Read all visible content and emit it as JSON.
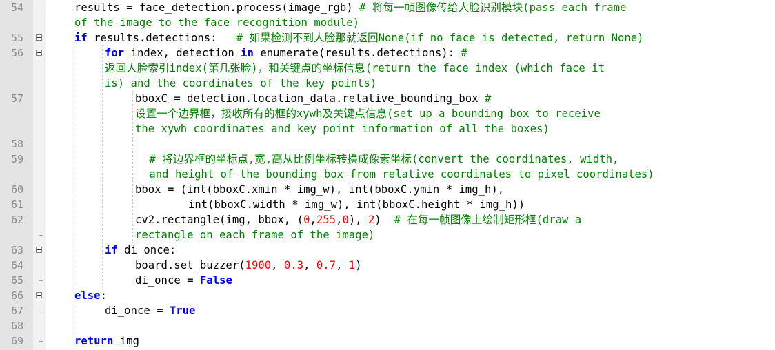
{
  "editor": {
    "lines": [
      {
        "num": "54",
        "segments": [
          {
            "t": "results = face_detection.process(image_rgb) ",
            "c": "plain"
          },
          {
            "t": "# 将每一帧图像传给人脸识别模块(pass each frame",
            "c": "cm"
          }
        ]
      },
      {
        "num": "",
        "segments": [
          {
            "t": "of the image to the face recognition module)",
            "c": "cm"
          }
        ]
      },
      {
        "num": "55",
        "segments": [
          {
            "t": "if",
            "c": "kw"
          },
          {
            "t": " results.detections:   ",
            "c": "plain"
          },
          {
            "t": "# 如果检测不到人脸那就返回None(if no face is detected, return None)",
            "c": "cm"
          }
        ]
      },
      {
        "num": "56",
        "segments": [
          {
            "t": "for",
            "c": "kw"
          },
          {
            "t": " index, detection ",
            "c": "plain"
          },
          {
            "t": "in",
            "c": "kw"
          },
          {
            "t": " enumerate(results.detections): ",
            "c": "plain"
          },
          {
            "t": "#",
            "c": "cm"
          }
        ]
      },
      {
        "num": "",
        "segments": [
          {
            "t": "返回人脸索引index(第几张脸)，和关键点的坐标信息(return the face index (which face it",
            "c": "cm"
          }
        ]
      },
      {
        "num": "",
        "segments": [
          {
            "t": "is) and the coordinates of the key points)",
            "c": "cm"
          }
        ]
      },
      {
        "num": "57",
        "segments": [
          {
            "t": "bboxC = detection.location_data.relative_bounding_box ",
            "c": "plain"
          },
          {
            "t": "#",
            "c": "cm"
          }
        ]
      },
      {
        "num": "",
        "segments": [
          {
            "t": "设置一个边界框，接收所有的框的xywh及关键点信息(set up a bounding box to receive",
            "c": "cm"
          }
        ]
      },
      {
        "num": "",
        "segments": [
          {
            "t": "the xywh coordinates and key point information of all the boxes)",
            "c": "cm"
          }
        ]
      },
      {
        "num": "58",
        "segments": []
      },
      {
        "num": "59",
        "segments": [
          {
            "t": " # 将边界框的坐标点,宽,高从比例坐标转换成像素坐标(convert the coordinates, width,",
            "c": "cm"
          }
        ]
      },
      {
        "num": "",
        "segments": [
          {
            "t": " and height of the bounding box from relative coordinates to pixel coordinates)",
            "c": "cm"
          }
        ]
      },
      {
        "num": "60",
        "segments": [
          {
            "t": "bbox = (int(bboxC.xmin * img_w), int(bboxC.ymin * img_h),",
            "c": "plain"
          }
        ]
      },
      {
        "num": "61",
        "segments": [
          {
            "t": "int(bboxC.width * img_w), int(bboxC.height * img_h))",
            "c": "plain"
          }
        ]
      },
      {
        "num": "62",
        "segments": [
          {
            "t": "cv2.rectangle(img, bbox, (",
            "c": "plain"
          },
          {
            "t": "0",
            "c": "num"
          },
          {
            "t": ",",
            "c": "plain"
          },
          {
            "t": "255",
            "c": "num"
          },
          {
            "t": ",",
            "c": "plain"
          },
          {
            "t": "0",
            "c": "num"
          },
          {
            "t": "), ",
            "c": "plain"
          },
          {
            "t": "2",
            "c": "num"
          },
          {
            "t": ")  ",
            "c": "plain"
          },
          {
            "t": "# 在每一帧图像上绘制矩形框(draw a",
            "c": "cm"
          }
        ]
      },
      {
        "num": "",
        "segments": [
          {
            "t": "rectangle on each frame of the image)",
            "c": "cm"
          }
        ]
      },
      {
        "num": "63",
        "segments": [
          {
            "t": "if",
            "c": "kw"
          },
          {
            "t": " di_once:",
            "c": "plain"
          }
        ]
      },
      {
        "num": "64",
        "segments": [
          {
            "t": "board.set_buzzer(",
            "c": "plain"
          },
          {
            "t": "1900",
            "c": "num"
          },
          {
            "t": ", ",
            "c": "plain"
          },
          {
            "t": "0.3",
            "c": "num"
          },
          {
            "t": ", ",
            "c": "plain"
          },
          {
            "t": "0.7",
            "c": "num"
          },
          {
            "t": ", ",
            "c": "plain"
          },
          {
            "t": "1",
            "c": "num"
          },
          {
            "t": ")",
            "c": "plain"
          }
        ]
      },
      {
        "num": "65",
        "segments": [
          {
            "t": "di_once = ",
            "c": "plain"
          },
          {
            "t": "False",
            "c": "kw"
          }
        ]
      },
      {
        "num": "66",
        "segments": [
          {
            "t": "else",
            "c": "kw"
          },
          {
            "t": ":",
            "c": "plain"
          }
        ]
      },
      {
        "num": "67",
        "segments": [
          {
            "t": "di_once = ",
            "c": "plain"
          },
          {
            "t": "True",
            "c": "kw"
          }
        ]
      },
      {
        "num": "68",
        "segments": []
      },
      {
        "num": "69",
        "segments": [
          {
            "t": "return",
            "c": "kw"
          },
          {
            "t": " img",
            "c": "plain"
          }
        ]
      }
    ]
  },
  "colors": {
    "keyword": "#0000ff",
    "number": "#ff0000",
    "comment": "#008000",
    "line_number": "#8a8a8a",
    "gutter": "#e4e4e4"
  }
}
